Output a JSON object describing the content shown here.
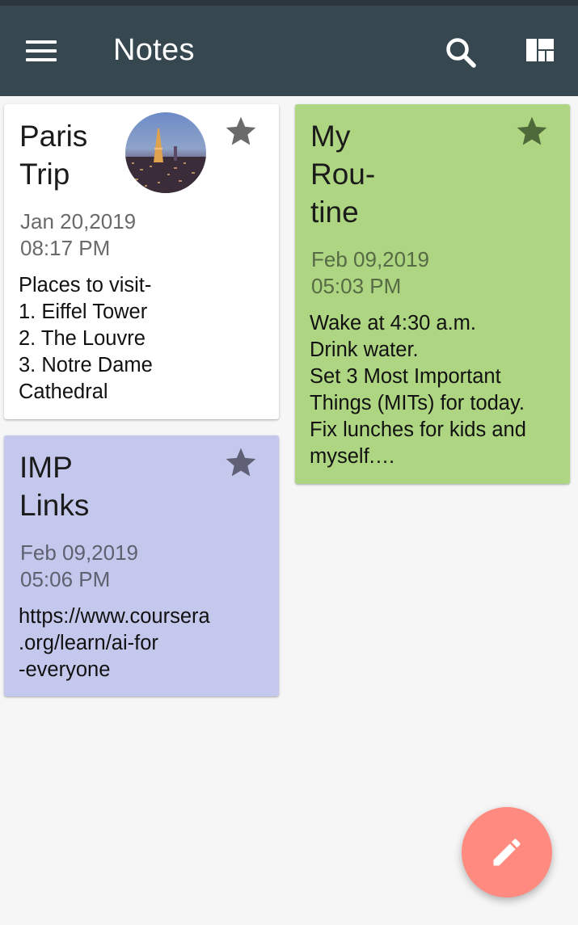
{
  "app": {
    "title": "Notes"
  },
  "icons": {
    "menu": "menu-icon",
    "search": "search-icon",
    "layout": "staggered-layout-icon",
    "star": "star-icon",
    "edit": "pencil-icon"
  },
  "colors": {
    "appbar": "#37474f",
    "note_white": "#ffffff",
    "note_green": "#aed581",
    "note_purple": "#c5c8ed",
    "fab": "#ff8a80"
  },
  "notes": [
    {
      "title": "Paris\nTrip",
      "date": "Jan 20,2019\n08:17 PM",
      "body": "Places to visit-\n1. Eiffel Tower\n2. The Louvre\n3. Notre Dame\nCathedral",
      "starred": true,
      "has_image": true
    },
    {
      "title": "IMP\nLinks",
      "date": "Feb 09,2019\n05:06 PM",
      "body": "https://www.coursera\n.org/learn/ai-for\n-everyone",
      "starred": true,
      "has_image": false
    },
    {
      "title": "My\nRou-\ntine",
      "date": "Feb 09,2019\n05:03 PM",
      "body": "Wake at 4:30 a.m.\nDrink water.\nSet 3 Most Important\nThings (MITs) for today.\nFix lunches for kids and\nmyself.…",
      "starred": true,
      "has_image": false
    }
  ]
}
